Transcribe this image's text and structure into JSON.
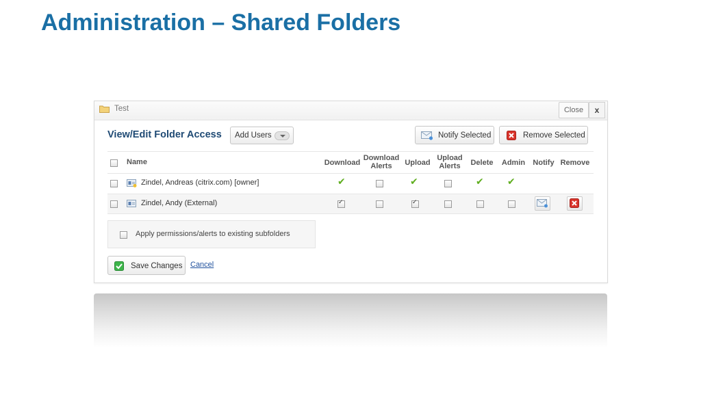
{
  "slide": {
    "title": "Administration – Shared Folders"
  },
  "dialog": {
    "folder_name": "Test",
    "close_label": "Close",
    "close_x": "x"
  },
  "toolbar": {
    "section_title": "View/Edit Folder Access",
    "add_users_label": "Add Users",
    "notify_selected_label": "Notify Selected",
    "remove_selected_label": "Remove Selected"
  },
  "table": {
    "headers": {
      "name": "Name",
      "download": "Download",
      "download_alerts": "Download Alerts",
      "upload": "Upload",
      "upload_alerts": "Upload Alerts",
      "delete": "Delete",
      "admin": "Admin",
      "notify": "Notify",
      "remove": "Remove"
    },
    "rows": [
      {
        "name": "Zindel, Andreas (citrix.com) [owner]",
        "icon": "owner-user-icon",
        "download": "granted",
        "download_alerts": false,
        "upload": "granted",
        "upload_alerts": false,
        "delete": "granted",
        "admin": "granted"
      },
      {
        "name": "Zindel, Andy (External)",
        "icon": "user-icon",
        "download": true,
        "download_alerts": false,
        "upload": true,
        "upload_alerts": false,
        "delete": false,
        "admin": false
      }
    ]
  },
  "footer": {
    "apply_label": "Apply permissions/alerts to existing subfolders",
    "save_label": "Save Changes",
    "cancel_label": "Cancel"
  },
  "colors": {
    "title": "#1a6fa5",
    "section_title": "#1f4a74",
    "tick": "#5fae1f",
    "remove_red": "#d9342b",
    "save_green": "#3db54a",
    "link": "#1e4f9c"
  }
}
